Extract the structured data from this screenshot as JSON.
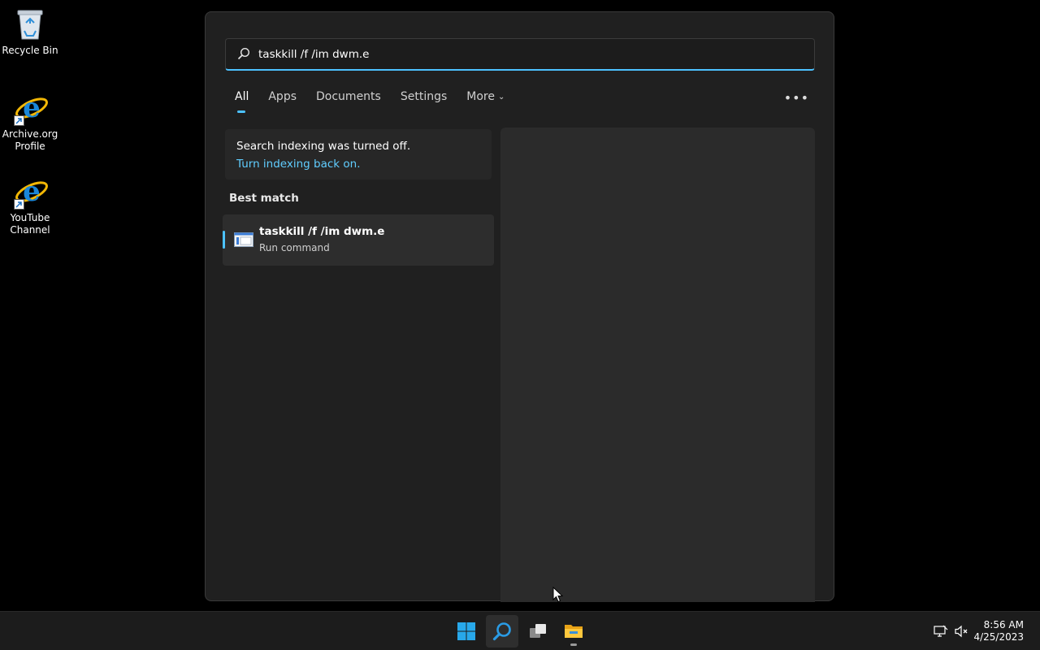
{
  "desktop": {
    "icons": [
      {
        "label": "Recycle Bin"
      },
      {
        "label": "Archive.org Profile"
      },
      {
        "label": "YouTube Channel"
      }
    ]
  },
  "search": {
    "query": "taskkill /f /im dwm.e",
    "tabs": [
      "All",
      "Apps",
      "Documents",
      "Settings",
      "More"
    ],
    "active_tab": "All",
    "more_icon": "ellipsis-icon"
  },
  "indexing": {
    "message": "Search indexing was turned off.",
    "link": "Turn indexing back on."
  },
  "best_match": {
    "heading": "Best match",
    "title": "taskkill /f /im dwm.e",
    "subtitle": "Run command",
    "icon": "run-command-icon"
  },
  "taskbar": {
    "buttons": [
      "start-icon",
      "search-icon",
      "task-view-icon",
      "file-explorer-icon"
    ],
    "tray": [
      "network-icon",
      "volume-muted-icon"
    ],
    "time": "8:56 AM",
    "date": "4/25/2023"
  },
  "colors": {
    "accent": "#4cc2ff",
    "link": "#60cdff",
    "panel": "#202020"
  }
}
